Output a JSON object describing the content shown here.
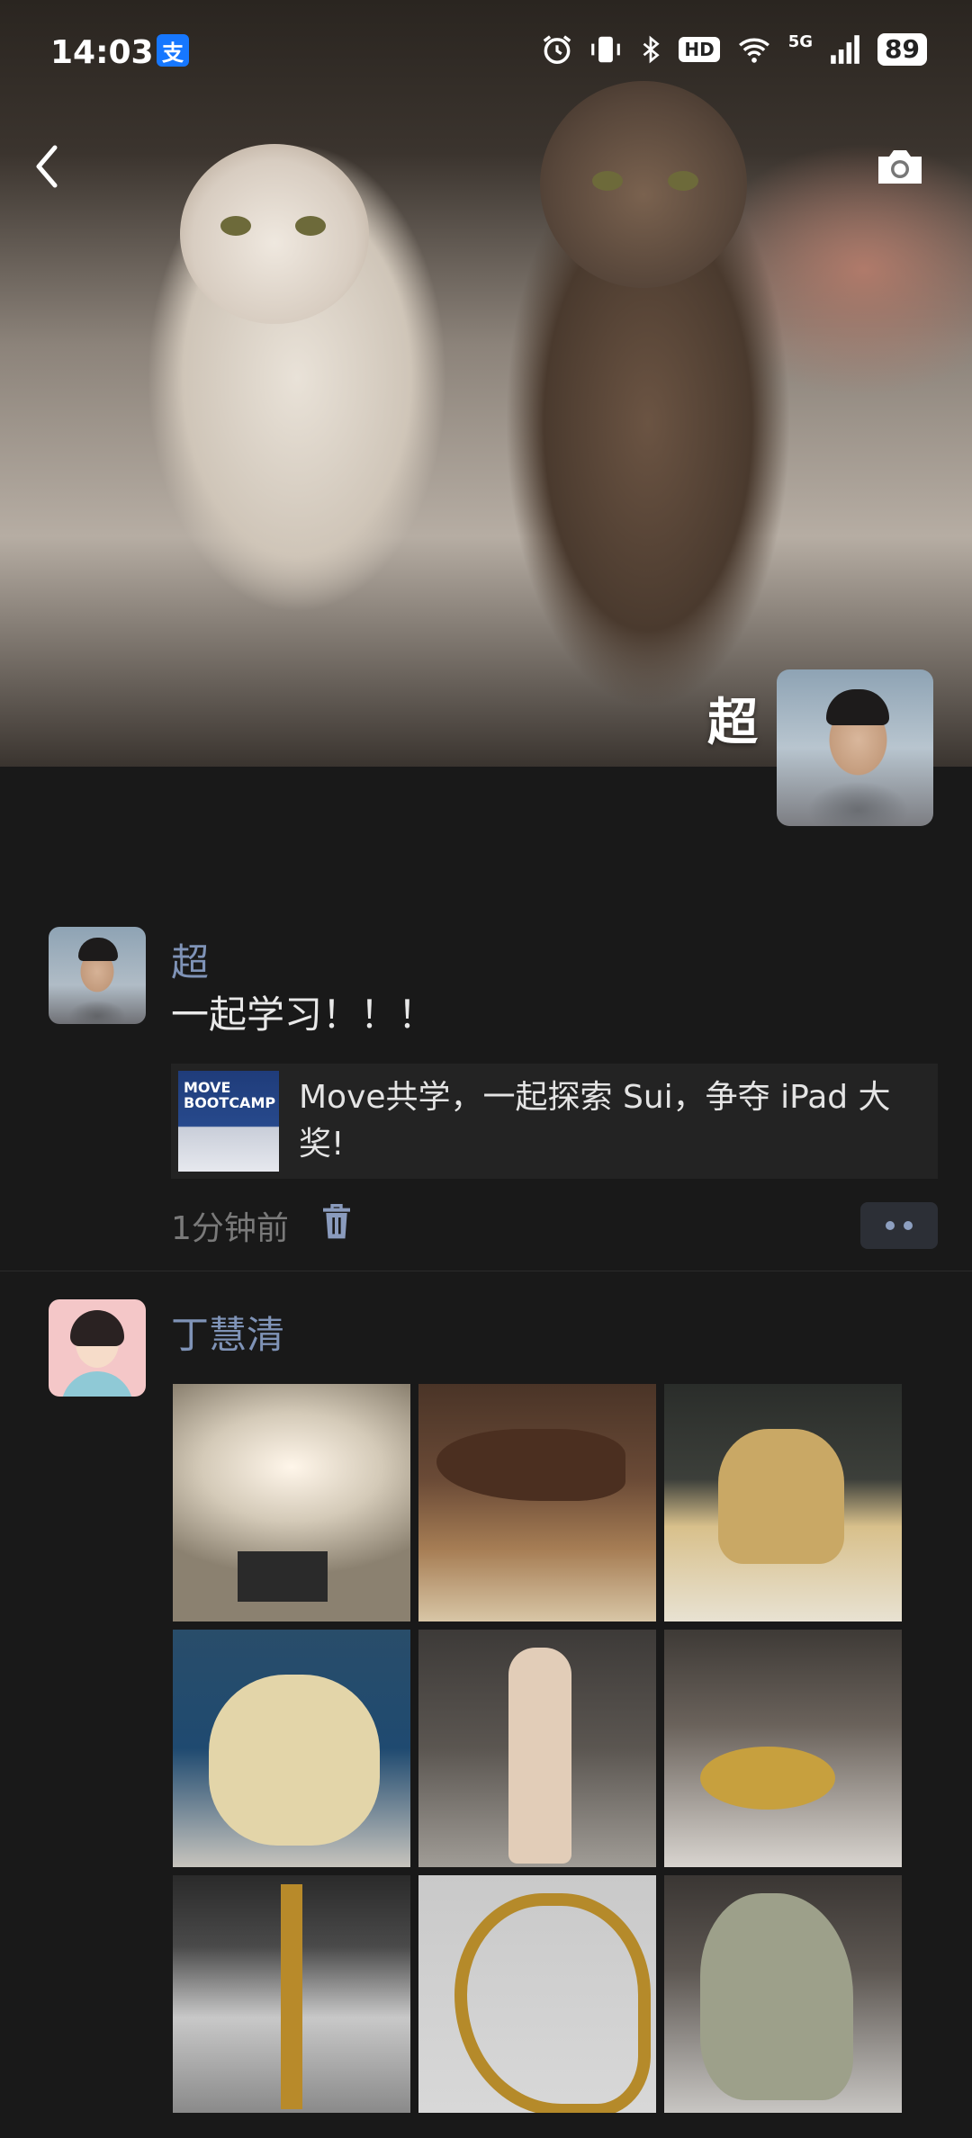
{
  "status_bar": {
    "time": "14:03",
    "alipay_badge": "支",
    "hd_badge": "HD",
    "network": "5G",
    "battery": "89"
  },
  "cover": {
    "user_name": "超"
  },
  "posts": [
    {
      "author": "超",
      "text": "一起学习！！！",
      "link": {
        "title": "Move共学，一起探索 Sui，争夺 iPad 大奖!",
        "thumb_text": "MOVE BOOTCAMP"
      },
      "time": "1分钟前"
    },
    {
      "author": "丁慧清",
      "photos": [
        "museum-photo-1",
        "museum-photo-2",
        "museum-photo-3",
        "museum-photo-4",
        "museum-photo-5",
        "museum-photo-6",
        "museum-photo-7",
        "museum-photo-8",
        "museum-photo-9"
      ]
    }
  ],
  "colors": {
    "background": "#191919",
    "author_name": "#7f93b7",
    "link_card": "#232323"
  }
}
